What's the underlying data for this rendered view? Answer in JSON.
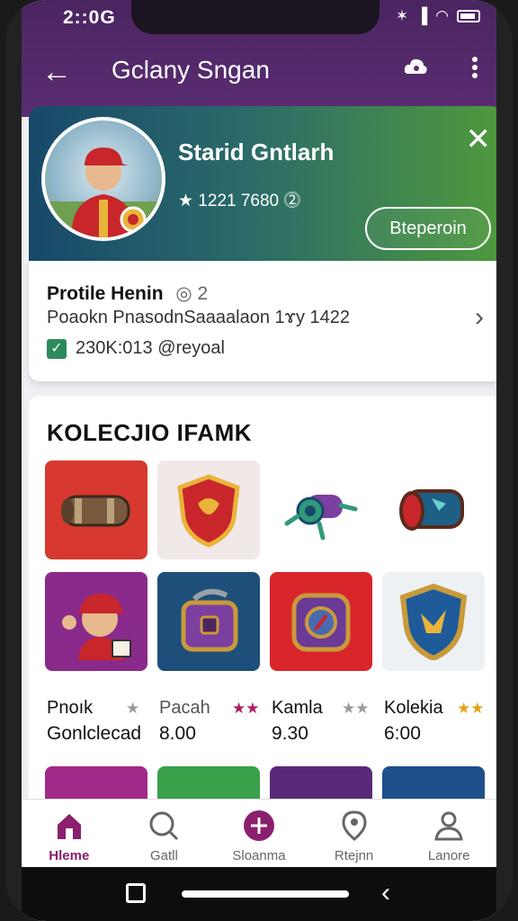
{
  "status": {
    "time": "2::0G",
    "icons_text": "὏6 ▮",
    "wifi_text": "≡"
  },
  "header": {
    "title": "Gclany Sngan"
  },
  "banner": {
    "name": "Starid Gntlarh",
    "stats": "★ 1221 7680 ⓶",
    "button_label": "Bteperoin"
  },
  "info": {
    "title": "Protile Henin",
    "count": "◎ 2",
    "line2": "Poaokn PnasodnSaaaalaon 1ɤy 1422",
    "line3": "230K:013 @reyoal"
  },
  "collection": {
    "title": "KOLECJIO IFAMK",
    "cards": [
      {
        "name": "Pnoık",
        "star": "★",
        "star_color": "#9a9a9a",
        "value": "Gonlclecad"
      },
      {
        "name": "Pacah",
        "star": "★★",
        "star_color": "#b01e63",
        "value": "8.00"
      },
      {
        "name": "Kamla",
        "star": "★★",
        "star_color": "#9a9a9a",
        "value": "9.30"
      },
      {
        "name": "Kolekia",
        "star": "★★",
        "star_color": "#e4a11a",
        "value": "6:00"
      }
    ]
  },
  "bottom_nav": [
    {
      "label": "Hleme",
      "icon": "home-icon",
      "active": true
    },
    {
      "label": "Gatll",
      "icon": "search-icon",
      "active": false
    },
    {
      "label": "Sloanma",
      "icon": "add-circle-icon",
      "active": false
    },
    {
      "label": "Rtejnn",
      "icon": "location-icon",
      "active": false
    },
    {
      "label": "Lanore",
      "icon": "profile-icon",
      "active": false
    }
  ],
  "colors": {
    "header": "#5b2d73",
    "accent": "#8a1f6e",
    "banner_left": "#17496a",
    "banner_right": "#4f9a3c"
  }
}
